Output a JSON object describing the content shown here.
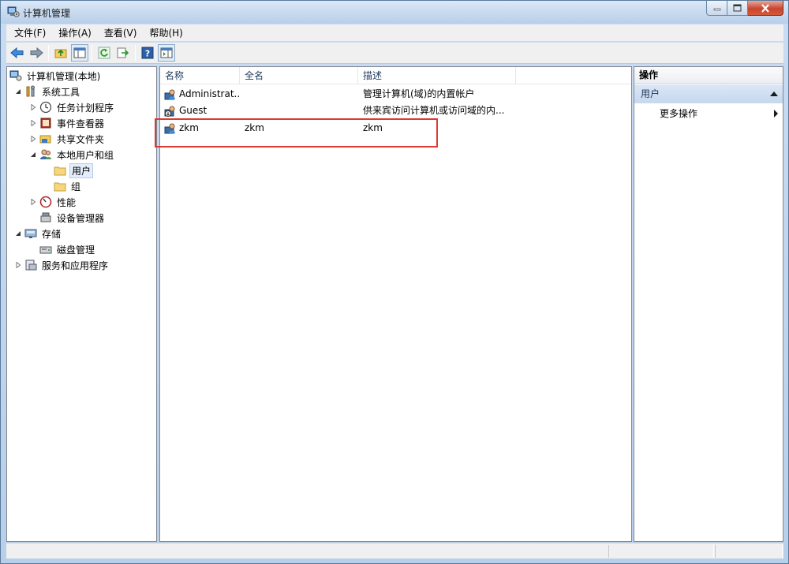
{
  "window": {
    "title": "计算机管理"
  },
  "menu": [
    "文件(F)",
    "操作(A)",
    "查看(V)",
    "帮助(H)"
  ],
  "toolbar": {
    "buttons": [
      "back-icon",
      "forward-icon",
      "up-folder-icon",
      "show-hide-tree-icon",
      "refresh-icon",
      "export-list-icon",
      "help-icon",
      "show-hide-action-icon"
    ]
  },
  "tree": {
    "root": "计算机管理(本地)",
    "system_tools": "系统工具",
    "task_scheduler": "任务计划程序",
    "event_viewer": "事件查看器",
    "shared_folders": "共享文件夹",
    "local_users_groups": "本地用户和组",
    "users": "用户",
    "groups": "组",
    "performance": "性能",
    "device_manager": "设备管理器",
    "storage": "存储",
    "disk_management": "磁盘管理",
    "services_apps": "服务和应用程序"
  },
  "list": {
    "columns": {
      "name": "名称",
      "fullname": "全名",
      "description": "描述"
    },
    "rows": [
      {
        "name": "Administrat...",
        "fullname": "",
        "description": "管理计算机(域)的内置帐户"
      },
      {
        "name": "Guest",
        "fullname": "",
        "description": "供来宾访问计算机或访问域的内..."
      },
      {
        "name": "zkm",
        "fullname": "zkm",
        "description": "zkm"
      }
    ]
  },
  "actions": {
    "header": "操作",
    "section": "用户",
    "more": "更多操作"
  },
  "colors": {
    "highlight": "#e0392f",
    "selection": "#e4eefa"
  }
}
